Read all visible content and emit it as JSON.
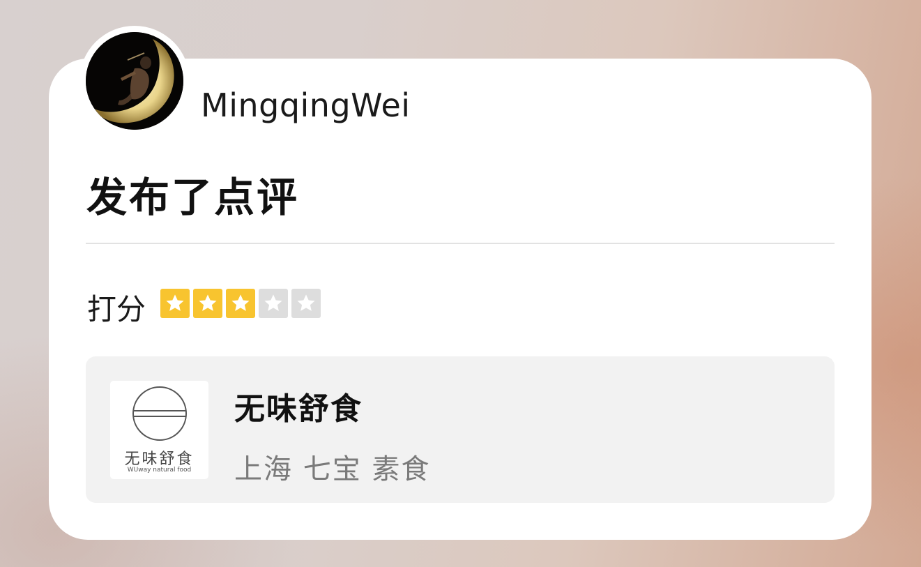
{
  "post": {
    "username": "MingqingWei",
    "headline": "发布了点评",
    "avatar": "moon-avatar"
  },
  "rating": {
    "label": "打分",
    "value": 3,
    "max": 5,
    "filled_color": "#f8c42f",
    "empty_color": "#dddddd"
  },
  "place": {
    "name": "无味舒食",
    "meta": "上海 七宝 素食",
    "logo_text": "无味舒食",
    "logo_subtext": "WUway natural food"
  }
}
